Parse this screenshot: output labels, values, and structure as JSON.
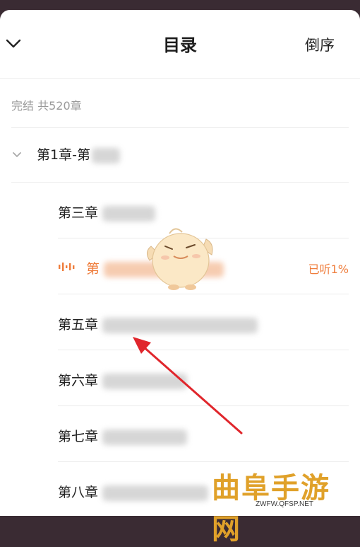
{
  "header": {
    "title": "目录",
    "reverse_label": "倒序",
    "collapse_icon": "chevron-down-icon"
  },
  "summary": "完结 共520章",
  "group": {
    "title": "第1章-第",
    "expanded_icon": "chevron-down-icon"
  },
  "chapters": [
    {
      "title": "第三章",
      "state": "normal"
    },
    {
      "title": "第",
      "state": "playing",
      "progress": "已听1%"
    },
    {
      "title": "第五章",
      "state": "normal"
    },
    {
      "title": "第六章",
      "state": "normal"
    },
    {
      "title": "第七章",
      "state": "normal"
    },
    {
      "title": "第八章",
      "state": "normal"
    }
  ],
  "watermark": {
    "brand": "曲阜手游网",
    "url": "ZWFW.QFSP.NET"
  },
  "colors": {
    "accent": "#ef7d3c",
    "arrow": "#e0262c",
    "watermark": "#e0a12a"
  }
}
